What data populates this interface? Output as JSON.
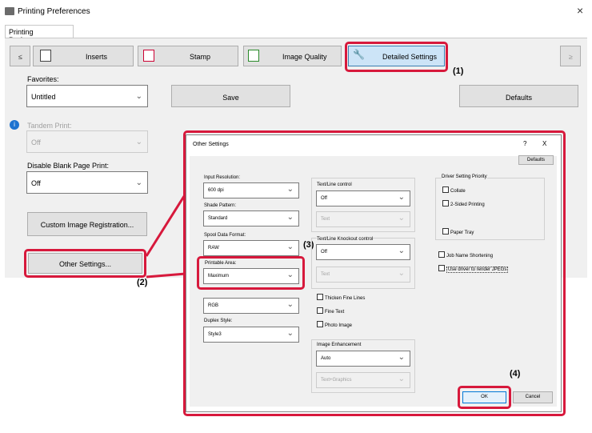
{
  "window": {
    "title": "Printing Preferences",
    "close": "×"
  },
  "tab": "Printing Preferences",
  "toolbar": {
    "prev": "≤",
    "next": "≥",
    "inserts": "Inserts",
    "stamp": "Stamp",
    "image_quality": "Image Quality",
    "detailed": "Detailed Settings"
  },
  "favorites": {
    "label": "Favorites:",
    "value": "Untitled"
  },
  "save": "Save",
  "defaults": "Defaults",
  "tandem": {
    "label": "Tandem Print:",
    "value": "Off"
  },
  "blank": {
    "label": "Disable Blank Page Print:",
    "value": "Off"
  },
  "custom_image": "Custom Image Registration...",
  "other_settings_btn": "Other Settings...",
  "callouts": {
    "c1": "(1)",
    "c2": "(2)",
    "c3": "(3)",
    "c4": "(4)"
  },
  "dialog": {
    "title": "Other Settings",
    "help": "?",
    "close": "X",
    "defaults": "Defaults",
    "input_res": {
      "label": "Input Resolution:",
      "value": "600 dpi"
    },
    "shade": {
      "label": "Shade Pattern:",
      "value": "Standard"
    },
    "spool": {
      "label": "Spool Data Format:",
      "value": "RAW"
    },
    "printable": {
      "label": "Printable Area:",
      "value": "Maximum"
    },
    "color": {
      "value": "RGB"
    },
    "duplex": {
      "label": "Duplex Style:",
      "value": "Style3"
    },
    "text_line": {
      "label": "Text/Line control",
      "value": "Off",
      "sub": "Text"
    },
    "knockout": {
      "label": "Text/Line Knockout control",
      "value": "Off",
      "sub": "Text"
    },
    "thicken": "Thicken Fine Lines",
    "fine_text": "Fine Text",
    "photo": "Photo Image",
    "enhance": {
      "label": "Image Enhancement",
      "value": "Auto",
      "sub": "Text+Graphics"
    },
    "priority": {
      "label": "Driver Setting Priority",
      "collate": "Collate",
      "two_sided": "2-Sided Printing",
      "paper_tray": "Paper Tray"
    },
    "job_name": "Job Name Shortening",
    "jpeg": "Use driver to render JPEGs",
    "ok": "OK",
    "cancel": "Cancel"
  }
}
